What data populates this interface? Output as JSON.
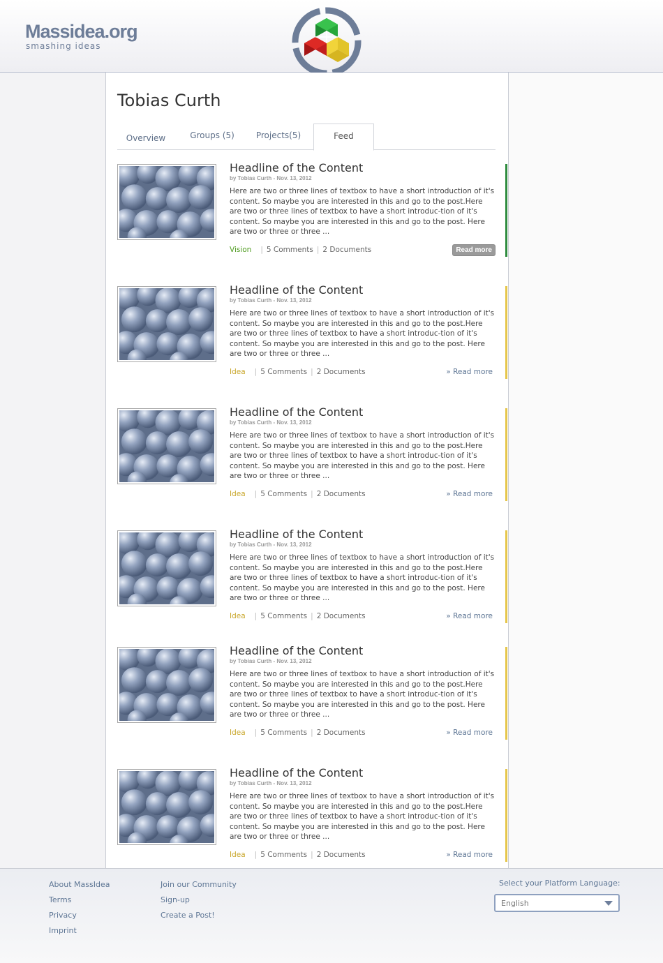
{
  "header": {
    "logo_title": "Massidea.org",
    "logo_subtitle": "smashing ideas",
    "emblem": "massidea-emblem-icon"
  },
  "profile": {
    "name": "Tobias Curth"
  },
  "tabs": [
    {
      "label": "Overview",
      "active": false
    },
    {
      "label": "Groups (5)",
      "active": false
    },
    {
      "label": "Projects(5)",
      "active": false
    },
    {
      "label": "Feed",
      "active": true
    }
  ],
  "feed": {
    "items": [
      {
        "headline": "Headline of the Content",
        "byline": "by Tobias Curth  -  Nov. 13, 2012",
        "excerpt": "Here are two or three lines of textbox to have a short introduction of it's content. So maybe you are interested in this and go to the post.Here are two or three lines of textbox to have a short introduc-tion of it's content. So maybe you are interested in this and go to the post.  Here are two or three or three ...",
        "category": "Vision",
        "category_color": "#4d9a1d",
        "accent_color": "#2e8b3e",
        "comments": "5 Comments",
        "documents": "2 Documents",
        "read_more": "Read more",
        "read_more_style": "button"
      },
      {
        "headline": "Headline of the Content",
        "byline": "by Tobias Curth  -  Nov. 13, 2012",
        "excerpt": "Here are two or three lines of textbox to have a short introduction of it's content. So maybe you are interested in this and go to the post.Here are two or three lines of textbox to have a short introduc-tion of it's content. So maybe you are interested in this and go to the post.  Here are two or three or three ...",
        "category": "Idea",
        "category_color": "#c9a72c",
        "accent_color": "#e6c64a",
        "comments": "5 Comments",
        "documents": "2 Documents",
        "read_more": "» Read more",
        "read_more_style": "link"
      },
      {
        "headline": "Headline of the Content",
        "byline": "by Tobias Curth  -  Nov. 13, 2012",
        "excerpt": "Here are two or three lines of textbox to have a short introduction of it's content. So maybe you are interested in this and go to the post.Here are two or three lines of textbox to have a short introduc-tion of it's content. So maybe you are interested in this and go to the post.  Here are two or three or three ...",
        "category": "Idea",
        "category_color": "#c9a72c",
        "accent_color": "#e6c64a",
        "comments": "5 Comments",
        "documents": "2 Documents",
        "read_more": "» Read more",
        "read_more_style": "link"
      },
      {
        "headline": "Headline of the Content",
        "byline": "by Tobias Curth  -  Nov. 13, 2012",
        "excerpt": "Here are two or three lines of textbox to have a short introduction of it's content. So maybe you are interested in this and go to the post.Here are two or three lines of textbox to have a short introduc-tion of it's content. So maybe you are interested in this and go to the post.  Here are two or three or three ...",
        "category": "Idea",
        "category_color": "#c9a72c",
        "accent_color": "#e6c64a",
        "comments": "5 Comments",
        "documents": "2 Documents",
        "read_more": "» Read more",
        "read_more_style": "link"
      },
      {
        "headline": "Headline of the Content",
        "byline": "by Tobias Curth  -  Nov. 13, 2012",
        "excerpt": "Here are two or three lines of textbox to have a short introduction of it's content. So maybe you are interested in this and go to the post.Here are two or three lines of textbox to have a short introduc-tion of it's content. So maybe you are interested in this and go to the post.  Here are two or three or three ...",
        "category": "Idea",
        "category_color": "#c9a72c",
        "accent_color": "#e6c64a",
        "comments": "5 Comments",
        "documents": "2 Documents",
        "read_more": "» Read more",
        "read_more_style": "link"
      },
      {
        "headline": "Headline of the Content",
        "byline": "by Tobias Curth  -  Nov. 13, 2012",
        "excerpt": "Here are two or three lines of textbox to have a short introduction of it's content. So maybe you are interested in this and go to the post.Here are two or three lines of textbox to have a short introduc-tion of it's content. So maybe you are interested in this and go to the post.  Here are two or three or three ...",
        "category": "Idea",
        "category_color": "#c9a72c",
        "accent_color": "#e6c64a",
        "comments": "5 Comments",
        "documents": "2 Documents",
        "read_more": "» Read more",
        "read_more_style": "link"
      }
    ]
  },
  "footer": {
    "col1": [
      "About MassIdea",
      "Terms",
      "Privacy",
      "Imprint"
    ],
    "col2": [
      "Join our Community",
      "Sign-up",
      "Create a Post!"
    ],
    "language_label": "Select your Platform Language:",
    "language_value": "English"
  }
}
